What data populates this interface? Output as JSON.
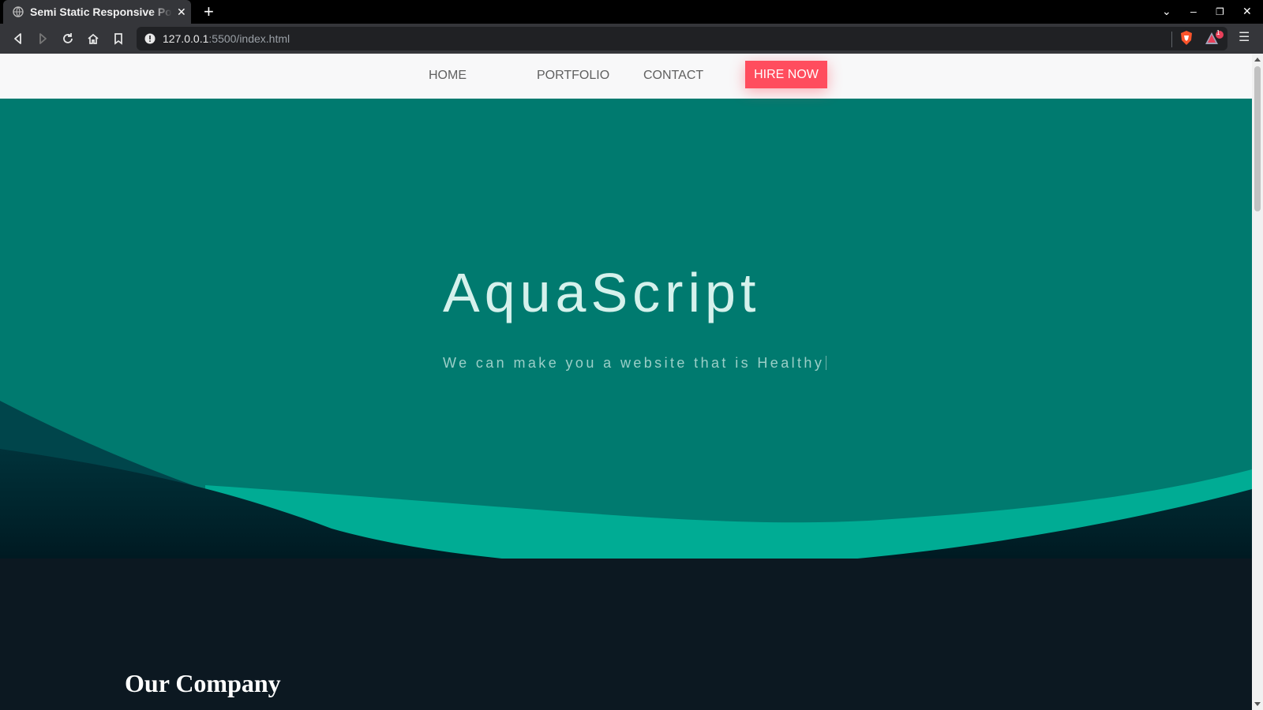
{
  "browser": {
    "tab_title": "Semi Static Responsive Portfolio",
    "url_host": "127.0.0.1",
    "url_rest": ":5500/index.html",
    "notification_count": "1"
  },
  "nav": {
    "home": "HOME",
    "portfolio": "PORTFOLIO",
    "contact": "CONTACT",
    "hire": "HIRE NOW"
  },
  "hero": {
    "title": "AquaScript",
    "subtitle": "We can make you a website that is Healthy"
  },
  "section": {
    "heading": "Our Company"
  },
  "colors": {
    "hero_bg": "#007a6f",
    "wave_light": "#00ac94",
    "wave_dark": "#001f26",
    "accent": "#ff4d5e",
    "page_bg": "#0c1821"
  }
}
